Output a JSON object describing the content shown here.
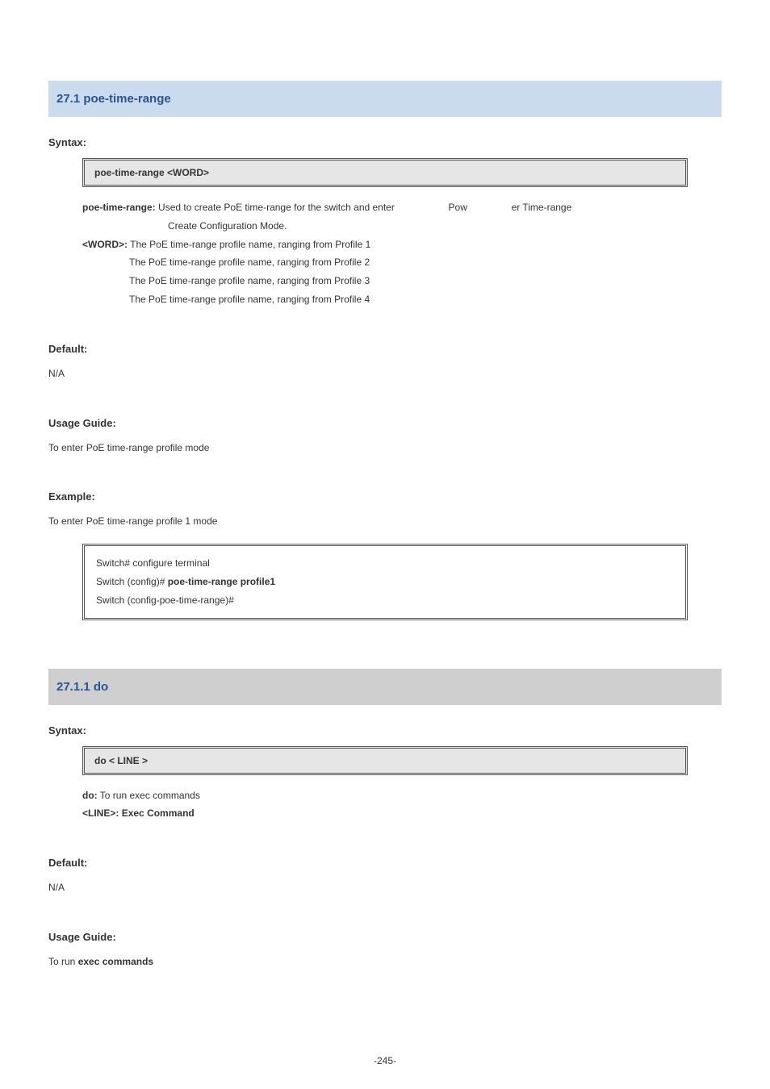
{
  "section1": {
    "title": "27.1 poe-time-range",
    "syntax_heading": "Syntax:",
    "syntax": "poe-time-range <WORD>",
    "params": {
      "p1_label": "poe-time-range:",
      "p1_desc_a": "Used to create PoE time-range for the switch and enter",
      "p1_desc_b": "Pow",
      "p1_desc_c": "er Time-range",
      "p1_desc_cont": "Create Configuration Mode.",
      "word_label": "<WORD>:",
      "word1": "The PoE time-range profile name, ranging from Profile 1",
      "word2": "The PoE time-range profile name, ranging from Profile 2",
      "word3": "The PoE time-range profile name, ranging from Profile 3",
      "word4": "The PoE time-range profile name, ranging from Profile 4"
    },
    "default_heading": "Default:",
    "default_value": "N/A",
    "usage_heading": "Usage Guide:",
    "usage_text": "To enter PoE time-range profile mode",
    "example_heading": "Example:",
    "example_text": "To enter PoE time-range profile 1 mode",
    "example_box": {
      "l1": "Switch# configure terminal",
      "l2a": "Switch (config)#",
      "l2b": "poe-time-range profile1",
      "l3": "Switch (config-poe-time-range)#"
    }
  },
  "section2": {
    "title": "27.1.1 do",
    "syntax_heading": "Syntax:",
    "syntax": "do < LINE >",
    "params": {
      "do_label": "do:",
      "do_desc": "To run exec commands",
      "line_label": "<LINE>:",
      "line_desc": " Exec Command"
    },
    "default_heading": "Default:",
    "default_value": "N/A",
    "usage_heading": "Usage Guide:",
    "usage_text_a": "To run",
    "usage_text_b": "exec commands"
  },
  "page_num": "-245-"
}
